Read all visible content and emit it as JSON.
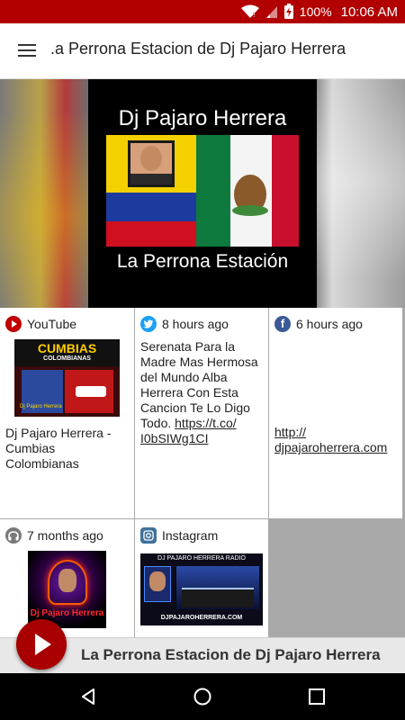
{
  "status": {
    "battery": "100%",
    "time": "10:06 AM",
    "icons": [
      "wifi-icon",
      "signal-icon",
      "battery-charging-icon"
    ],
    "bar_color": "#b20000"
  },
  "appbar": {
    "title": ".a Perrona Estacion de Dj Pajaro Herrera",
    "menu_icon": "hamburger-menu-icon"
  },
  "hero": {
    "cover_top_text": "Dj Pajaro Herrera",
    "cover_bottom_text": "La Perrona Estación"
  },
  "cards": {
    "youtube": {
      "source": "YouTube",
      "icon": "youtube-icon",
      "thumb_title": "CUMBIAS",
      "thumb_subtitle": "COLOMBIANAS",
      "thumb_caption": "Dj Pajaro Herrera",
      "text": "Dj Pajaro Herrera - Cumbias Colombianas"
    },
    "twitter": {
      "time": "8 hours ago",
      "icon": "twitter-icon",
      "text": "Serenata Para la Madre Mas Hermosa del Mundo Alba Herrera Con Esta Cancion Te Lo Digo Todo.",
      "link_line1": "https://t.co/",
      "link_line2": "I0bSIWg1CI"
    },
    "facebook": {
      "time": "6 hours ago",
      "icon": "facebook-icon",
      "link_line1": "http://",
      "link_line2": "djpajaroherrera.com"
    },
    "soundcloud": {
      "time": "7 months ago",
      "icon": "headphones-icon",
      "thumb_caption": "Dj Pajaro Herrera"
    },
    "instagram": {
      "source": "Instagram",
      "icon": "instagram-icon",
      "thumb_header": "DJ PAJARO HERRERA RADIO",
      "thumb_footer": "DJPAJAROHERRERA.COM"
    }
  },
  "player": {
    "title": "La Perrona Estacion de Dj Pajaro Herrera",
    "play_icon": "play-icon",
    "accent": "#a80000"
  },
  "navbar": {
    "icons": [
      "back-icon",
      "home-icon",
      "recents-icon"
    ]
  }
}
